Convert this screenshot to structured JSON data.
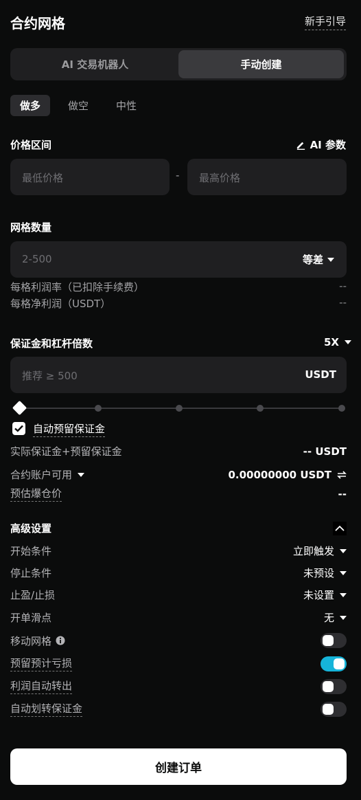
{
  "header": {
    "title": "合约网格",
    "guide": "新手引导"
  },
  "mode_tabs": {
    "ai": "AI 交易机器人",
    "manual": "手动创建"
  },
  "directions": [
    "做多",
    "做空",
    "中性"
  ],
  "price_range": {
    "label": "价格区间",
    "ai_param": "AI 参数",
    "min_placeholder": "最低价格",
    "separator": "-",
    "max_placeholder": "最高价格"
  },
  "grid": {
    "label": "网格数量",
    "placeholder": "2-500",
    "type": "等差",
    "profit_rate_label": "每格利润率（已扣除手续费）",
    "profit_rate_value": "--",
    "net_profit_label": "每格净利润（USDT）",
    "net_profit_value": "--"
  },
  "margin": {
    "label": "保证金和杠杆倍数",
    "leverage": "5X",
    "placeholder": "推荐 ≥ 500",
    "unit": "USDT",
    "auto_reserve_label": "自动预留保证金",
    "auto_reserve_checked": true,
    "actual_label": "实际保证金+预留保证金",
    "actual_value": "-- USDT",
    "available_label": "合约账户可用",
    "available_value": "0.00000000 USDT",
    "liq_label": "预估爆仓价",
    "liq_value": "--"
  },
  "advanced": {
    "label": "高级设置",
    "start_label": "开始条件",
    "start_value": "立即触发",
    "stop_label": "停止条件",
    "stop_value": "未预设",
    "tpsl_label": "止盈/止损",
    "tpsl_value": "未设置",
    "slippage_label": "开单滑点",
    "slippage_value": "无",
    "trailing_label": "移动网格",
    "trailing_on": false,
    "reserve_loss_label": "预留预计亏损",
    "reserve_loss_on": true,
    "auto_transfer_label": "利润自动转出",
    "auto_transfer_on": false,
    "auto_margin_label": "自动划转保证金",
    "auto_margin_on": false
  },
  "create_button": "创建订单",
  "colors": {
    "background": "#0b0c0c",
    "panel": "#1f1f21",
    "accent": "#16b4d9"
  }
}
